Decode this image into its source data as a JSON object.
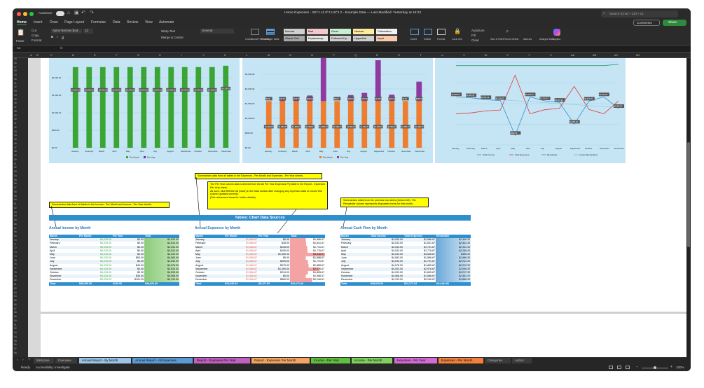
{
  "window": {
    "title": "Home Expenses - SE^J v1.0^J US^J 2 - Example Data — Last Modified: Yesterday at 15:23",
    "autosave_label": "AutoSave",
    "search_placeholder": "Search (Cmd + Ctrl + U)"
  },
  "menu": {
    "tabs": [
      "Home",
      "Insert",
      "Draw",
      "Page Layout",
      "Formulas",
      "Data",
      "Review",
      "View",
      "Automate"
    ],
    "comments_label": "Comments",
    "share_label": "Share"
  },
  "ribbon": {
    "paste": "Paste",
    "cut": "Cut",
    "copy": "Copy",
    "format": "Format",
    "font_name": "Aptos Narrow (Bod...",
    "font_size": "12",
    "wrap_text": "Wrap Text",
    "merge": "Merge & Centre",
    "number_format": "General",
    "conditional": "Conditional Formatting",
    "format_table": "Format as Table",
    "styles": [
      {
        "label": "Normal",
        "color": "#cfcfcf"
      },
      {
        "label": "Bad",
        "color": "#f4c7ce"
      },
      {
        "label": "Good",
        "color": "#c6efce"
      },
      {
        "label": "Neutral",
        "color": "#ffeb9c"
      },
      {
        "label": "Calculation",
        "color": "#f2f2f2"
      },
      {
        "label": "Check Cell",
        "color": "#a5a5a5"
      },
      {
        "label": "Explanatory...",
        "color": "#e7e6e6"
      },
      {
        "label": "Followed Hy...",
        "color": "#cfcfcf"
      },
      {
        "label": "Hyperlink",
        "color": "#cfcfcf"
      },
      {
        "label": "Input",
        "color": "#f8cbad"
      }
    ],
    "insert": "Insert",
    "delete": "Delete",
    "format_cells": "Format",
    "lock_cell": "Lock Cell",
    "autosum": "AutoSum",
    "fill": "Fill",
    "clear": "Clear",
    "sort_filter": "Sort & Filter",
    "find_select": "Find & Select",
    "addins": "Add-ins",
    "analyze": "Analyze Data",
    "copilot": "Copilot"
  },
  "formula_bar": {
    "cell_ref": "A1",
    "fx": "fx",
    "value": ""
  },
  "columns": [
    "A",
    "B",
    "C",
    "D",
    "E",
    "F",
    "G",
    "H",
    "I",
    "J",
    "K",
    "L",
    "M",
    "N",
    "O",
    "P",
    "Q",
    "R",
    "S",
    "T",
    "U",
    "V",
    "W",
    "X",
    "Y",
    "Z",
    "AA",
    "AB",
    "AC",
    "AD"
  ],
  "rows_start": 25,
  "rows_end": 98,
  "callouts": {
    "income": "Summarises data from all tables in the Income - Per Month and Income - Per Year sheets.",
    "expenses": "Summarises data from all tables in the Expenses - Per Month and Expenses - Per Year sheets.",
    "per_year_1": "The Per Year column data is derived from the All Per Year Expenses PQ table in the Report - Expenses Per Year sheet.",
    "per_year_2": "As such, click Refresh All (twice) in the Data toolbar after changing any expenses data to ensure this column updates correctly.",
    "per_year_3": "(See referenced sheet for further details)",
    "cashflow": "Summarises totals from the previous two tables (bottom left). The Remainder column represents disposable funds for that month."
  },
  "banner": "Tables: Chart Data Sources",
  "months": [
    "January",
    "February",
    "March",
    "April",
    "May",
    "June",
    "July",
    "August",
    "September",
    "October",
    "November",
    "December"
  ],
  "income_chart": {
    "type": "bar",
    "categories": [
      "January",
      "February",
      "March",
      "April",
      "May",
      "June",
      "July",
      "August",
      "September",
      "October",
      "November",
      "December"
    ],
    "series": [
      {
        "name": "Per Month",
        "values": [
          4033,
          4033,
          4033,
          4033,
          4033,
          4033,
          4033,
          4033,
          4033,
          4033,
          4033,
          4100
        ]
      },
      {
        "name": "Per Year",
        "values": [
          0,
          0,
          0,
          0,
          0,
          0,
          0,
          0,
          0,
          0,
          0,
          0
        ]
      }
    ],
    "data_labels": [
      "$4,033.00",
      "$4,033.00",
      "$4,033.00",
      "$4,033.00",
      "$4,033.00",
      "$4,033.00",
      "$4,033.00",
      "$4,033.00",
      "$4,033.00",
      "$4,033.00",
      "$4,033.00",
      "$4,100.00"
    ],
    "yticks": [
      "$0.00",
      "$500.00",
      "$1,000.00",
      "$1,500.00",
      "$2,000.00"
    ]
  },
  "expense_chart": {
    "type": "bar",
    "categories": [
      "January",
      "February",
      "March",
      "April",
      "May",
      "June",
      "July",
      "August",
      "September",
      "October",
      "November",
      "December"
    ],
    "series": [
      {
        "name": "Per Month",
        "values": [
          1586.67,
          1586.67,
          1586.67,
          1586.67,
          1586.67,
          1586.67,
          1586.67,
          1586.67,
          1586.67,
          1586.67,
          1586.67,
          1586.67
        ]
      },
      {
        "name": "Per Year",
        "values": [
          0,
          45,
          145,
          190,
          1960,
          0,
          205,
          279,
          1390,
          219,
          0,
          660
        ]
      }
    ],
    "month_labels": [
      "$1,586.67",
      "$1,586.67",
      "$1,586.67",
      "$1,586.67",
      "$1,586.67",
      "$1,586.67",
      "$1,586.67",
      "$1,586.67",
      "$1,586.67",
      "$1,586.67",
      "$1,586.67",
      "$1,586.67"
    ],
    "year_labels": [
      "$0.00",
      "$45.00",
      "$145.00",
      "$190.00",
      "",
      "$0.00",
      "$205.00",
      "$279.00",
      "$1,390.00",
      "$219.00",
      "$0.00",
      "$660.00"
    ],
    "yticks": [
      "$0.00",
      "$500.00",
      "$1,000.00",
      "$1,500.00",
      "$2,000.00",
      "$2,500.00"
    ]
  },
  "cashflow_chart": {
    "type": "line",
    "categories": [
      "January",
      "February",
      "March",
      "April",
      "May",
      "June",
      "July",
      "August",
      "September",
      "October",
      "November",
      "December"
    ],
    "series": [
      {
        "name": "Total Income",
        "values": [
          4033,
          4033,
          4033,
          4033,
          4033,
          4033,
          4033,
          4033,
          4033,
          4033,
          4033,
          4100
        ]
      },
      {
        "name": "Total Expenses",
        "values": [
          1586,
          1631,
          1731,
          1776,
          3547,
          1586,
          1791,
          1865,
          2976,
          1805,
          1586,
          2246
        ]
      },
      {
        "name": "Remainder",
        "values": [
          2446,
          2401,
          2301,
          2256,
          486,
          2446,
          2241,
          2167,
          1056,
          2227,
          2446,
          1853
        ]
      },
      {
        "name": "Linear (Remainder)",
        "values": [
          2450,
          2400,
          2350,
          2300,
          2250,
          2200,
          2150,
          2100,
          2050,
          2000,
          1950,
          1900
        ]
      }
    ],
    "labels": [
      "$2,446.33",
      "$2,401.33",
      "$2,301.33",
      "$2,256.33",
      "$486.33",
      "$2,446.33",
      "$2,241.33",
      "$2,167.33",
      "$1,056.33",
      "$2,227.33",
      "$2,446.33",
      "$1,853.33"
    ]
  },
  "income_table": {
    "title": "Annual Income by Month",
    "headers": [
      "Month",
      "Per Month",
      "Per Year",
      "Total"
    ],
    "rows": [
      [
        "January",
        "$4,033.00",
        "$0.00",
        "$4,033.00"
      ],
      [
        "February",
        "$4,033.00",
        "$0.00",
        "$4,033.00"
      ],
      [
        "March",
        "$4,033.00",
        "$0.00",
        "$4,033.00"
      ],
      [
        "April",
        "$4,033.00",
        "$0.00",
        "$4,033.00"
      ],
      [
        "May",
        "$4,033.00",
        "$0.00",
        "$4,033.00"
      ],
      [
        "June",
        "$4,033.00",
        "$50.00",
        "$4,083.00"
      ],
      [
        "July",
        "$4,033.00",
        "$0.00",
        "$4,033.00"
      ],
      [
        "August",
        "$4,033.00",
        "$45.00",
        "$4,078.00"
      ],
      [
        "September",
        "$4,033.00",
        "$0.00",
        "$4,033.00"
      ],
      [
        "October",
        "$4,033.00",
        "$0.00",
        "$4,033.00"
      ],
      [
        "November",
        "$4,033.00",
        "$35.00",
        "$4,068.00"
      ],
      [
        "December",
        "$4,033.00",
        "$100.00",
        "$4,133.00"
      ]
    ],
    "total": [
      "Total",
      "$48,396.00",
      "$230.00",
      "$48,626.00"
    ]
  },
  "expense_table": {
    "title": "Annual Expenses by Month",
    "headers": [
      "Month",
      "Per Month",
      "Per Year",
      "Total"
    ],
    "rows": [
      [
        "January",
        "$1,586.67",
        "$0.00",
        "$1,586.67"
      ],
      [
        "February",
        "$1,586.67",
        "$45.00",
        "$1,631.67"
      ],
      [
        "March",
        "$1,586.67",
        "$145.00",
        "$1,731.67"
      ],
      [
        "April",
        "$1,586.67",
        "$190.00",
        "$1,776.67"
      ],
      [
        "May",
        "$1,586.67",
        "$1,960.00",
        "$3,546.67"
      ],
      [
        "June",
        "$1,586.67",
        "$0.00",
        "$1,586.67"
      ],
      [
        "July",
        "$1,586.67",
        "$205.00",
        "$1,791.67"
      ],
      [
        "August",
        "$1,586.67",
        "$279.00",
        "$1,865.67"
      ],
      [
        "September",
        "$1,586.67",
        "$1,390.00",
        "$2,976.67"
      ],
      [
        "October",
        "$1,586.67",
        "$219.00",
        "$1,805.67"
      ],
      [
        "November",
        "$1,586.67",
        "$0.00",
        "$1,586.67"
      ],
      [
        "December",
        "$1,586.67",
        "$660.00",
        "$2,246.67"
      ]
    ],
    "total": [
      "Total",
      "$19,040.04",
      "$5,127.00",
      "$24,171.04"
    ]
  },
  "cashflow_table": {
    "title": "Annual Cash Flow by Month",
    "headers": [
      "Month",
      "Total Income",
      "Total Expenses",
      "Remainder"
    ],
    "rows": [
      [
        "January",
        "$4,033.00",
        "$1,586.67",
        "$2,446.33"
      ],
      [
        "February",
        "$4,033.00",
        "$1,631.67",
        "$2,401.33"
      ],
      [
        "March",
        "$4,033.00",
        "$1,731.67",
        "$2,301.33"
      ],
      [
        "April",
        "$4,033.00",
        "$1,776.67",
        "$2,256.33"
      ],
      [
        "May",
        "$4,033.00",
        "$3,546.67",
        "$486.33"
      ],
      [
        "June",
        "$4,083.00",
        "$1,586.67",
        "$2,496.33"
      ],
      [
        "July",
        "$4,033.00",
        "$1,791.67",
        "$2,241.33"
      ],
      [
        "August",
        "$4,078.00",
        "$1,865.67",
        "$2,212.33"
      ],
      [
        "September",
        "$4,033.00",
        "$2,976.67",
        "$1,056.33"
      ],
      [
        "October",
        "$4,033.00",
        "$1,805.67",
        "$2,227.33"
      ],
      [
        "November",
        "$4,068.00",
        "$1,586.67",
        "$2,481.33"
      ],
      [
        "December",
        "$4,133.00",
        "$2,246.67",
        "$1,886.33"
      ]
    ],
    "total": [
      "Total",
      "$48,626.00",
      "$24,171.04",
      "$24,454.96"
    ]
  },
  "sheet_tabs": [
    {
      "label": "Welcome",
      "color": "#3a3a3a"
    },
    {
      "label": "Overview",
      "color": "#3a3a3a"
    },
    {
      "label": "Annual Report - By Month",
      "color": "#9dc3e6"
    },
    {
      "label": "Annual Report - All Expenses",
      "color": "#5b9bd5"
    },
    {
      "label": "Report - Expenses Per Year",
      "color": "#c060c0"
    },
    {
      "label": "Report - Expenses Per Month",
      "color": "#f4a460"
    },
    {
      "label": "Income - Per Year",
      "color": "#5fbf3f"
    },
    {
      "label": "Income - Per Month",
      "color": "#7fd05f"
    },
    {
      "label": "Expenses - Per Year",
      "color": "#d46ad4"
    },
    {
      "label": "Expenses - Per Month",
      "color": "#f0803c"
    },
    {
      "label": "Categories",
      "color": "#3a3a3a"
    },
    {
      "label": "Author",
      "color": "#3a3a3a"
    }
  ],
  "status": {
    "ready": "Ready",
    "accessibility": "Accessibility: Investigate",
    "zoom": "100%"
  }
}
